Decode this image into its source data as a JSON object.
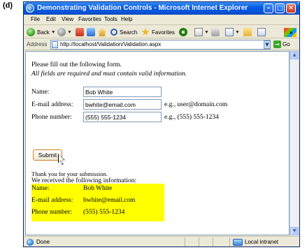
{
  "figure_label": "(d)",
  "window": {
    "title": "Demonstrating Validation Controls - Microsoft Internet Explorer",
    "minimize_glyph": "–",
    "maximize_glyph": "□",
    "close_glyph": "✕"
  },
  "menu": [
    "File",
    "Edit",
    "View",
    "Favorites",
    "Tools",
    "Help"
  ],
  "toolbar": {
    "back_label": "Back",
    "search_label": "Search",
    "favorites_label": "Favorites",
    "overflow_glyph": "»"
  },
  "address": {
    "label": "Address",
    "url": "http://localhost/Validation/Validation.aspx",
    "go_label": "Go"
  },
  "form": {
    "heading": "Please fill out the following form.",
    "subheading": "All fields are required and must contain valid information.",
    "fields": [
      {
        "label": "Name:",
        "value": "Bob White",
        "hint": ""
      },
      {
        "label": "E-mail address:",
        "value": "bwhite@email.com",
        "hint": "e.g., user@domain.com"
      },
      {
        "label": "Phone number:",
        "value": "(555) 555-1234",
        "hint": "e.g., (555) 555-1234"
      }
    ],
    "submit_label": "Submit"
  },
  "result": {
    "thanks": "Thank you for your submission.",
    "received": "We received the following information:",
    "rows": [
      {
        "label": "Name:",
        "value": "Bob White"
      },
      {
        "label": "E-mail address:",
        "value": "bwhite@email.com"
      },
      {
        "label": "Phone number:",
        "value": "(555) 555-1234"
      }
    ],
    "highlight_color": "#ffff00"
  },
  "status": {
    "left": "Done",
    "zone": "Local intranet"
  }
}
